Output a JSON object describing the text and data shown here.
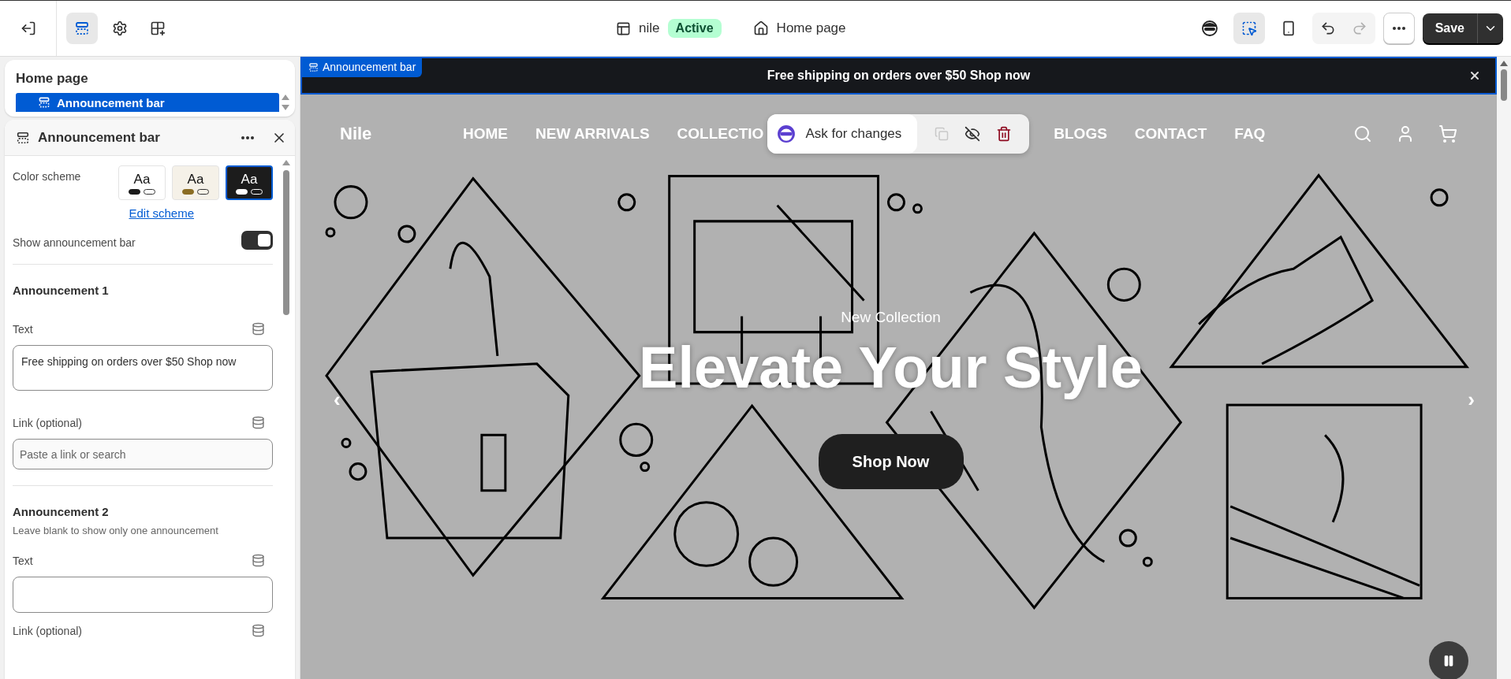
{
  "topbar": {
    "tools": [
      {
        "kind": "sections",
        "selected": true
      },
      {
        "kind": "settings",
        "selected": false
      },
      {
        "kind": "apps",
        "selected": false
      }
    ],
    "theme_name": "nile",
    "theme_status": "Active",
    "page": "Home page",
    "view_tools": [
      {
        "kind": "preview",
        "selected": false
      },
      {
        "kind": "inspector",
        "selected": true
      },
      {
        "kind": "mobile",
        "selected": false
      }
    ],
    "redo_disabled": true,
    "save": "Save"
  },
  "sidebar": {
    "title": "Home page",
    "items": [
      {
        "label": "Announcement bar",
        "selected": true
      }
    ]
  },
  "settings": {
    "title": "Announcement bar",
    "color_scheme": {
      "label": "Color scheme",
      "options": [
        {
          "kind": "light",
          "sample": "Aa",
          "color": "#1a1a1a",
          "selected": false
        },
        {
          "kind": "cream",
          "sample": "Aa",
          "color": "#8b6d24",
          "selected": false
        },
        {
          "kind": "dark",
          "sample": "Aa",
          "color": "#ffffff",
          "selected": true
        }
      ],
      "link": "Edit scheme"
    },
    "toggle": {
      "label": "Show announcement bar",
      "on": true
    },
    "announcements": [
      {
        "heading": "Announcement 1",
        "text_label": "Text",
        "text_value": "Free shipping on orders over $50 Shop now",
        "link_label": "Link (optional)",
        "link_placeholder": "Paste a link or search"
      },
      {
        "heading": "Announcement 2",
        "hint": "Leave blank to show only one announcement",
        "text_label": "Text",
        "link_label": "Link (optional)"
      }
    ]
  },
  "preview": {
    "tag": "Announcement bar",
    "announcement": "Free shipping on orders over $50 Shop now",
    "logo": "Nile",
    "nav_left": [
      "HOME",
      "NEW ARRIVALS",
      "COLLECTIO"
    ],
    "nav_right": [
      "BLOGS",
      "CONTACT",
      "FAQ"
    ],
    "popup": {
      "label": "Ask for changes",
      "duplicate_disabled": true
    },
    "hero": {
      "eyebrow": "New Collection",
      "headline": "Elevate Your Style",
      "button": "Shop Now",
      "prev": "‹",
      "next": "›"
    }
  }
}
